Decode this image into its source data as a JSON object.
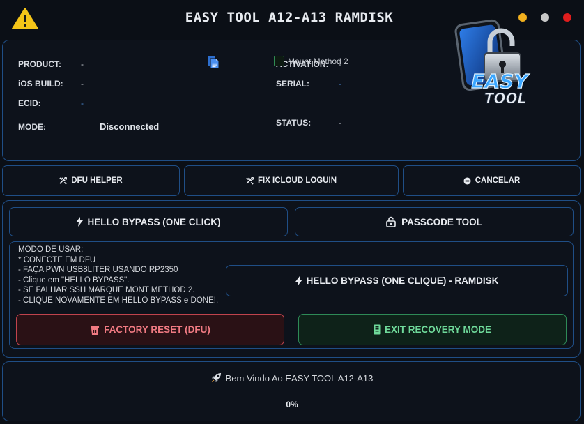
{
  "window": {
    "title": "EASY TOOL A12-A13 RAMDISK",
    "icon": "warning-icon",
    "controls": {
      "minimize_color": "#f2b01e",
      "maximize_color": "#c7c7c7",
      "close_color": "#e01d1d"
    }
  },
  "device_info": {
    "product_label": "PRODUCT:",
    "product_value": "-",
    "ios_build_label": "iOS BUILD:",
    "ios_build_value": "-",
    "ecid_label": "ECID:",
    "ecid_value": "-",
    "mode_label": "MODE:",
    "mode_value": "Disconnected",
    "activation_label": "ACTIVATION:",
    "activation_value": "-",
    "serial_label": "SERIAL:",
    "serial_value": "-",
    "mount_method_label": "Mount Method 2",
    "mount_method_checked": false,
    "status_label": "STATUS:",
    "status_value": "-",
    "copy_icon": "copy-icon"
  },
  "logo": {
    "line1": "EASY",
    "line2": "TOOL"
  },
  "toolbar": {
    "dfu_helper": "DFU HELPER",
    "fix_icloud": "FIX ICLOUD LOGUIN",
    "cancel": "CANCELAR"
  },
  "bypass": {
    "hello_bypass": "HELLO BYPASS (ONE CLICK)",
    "passcode_tool": "PASSCODE TOOL",
    "hello_bypass_ramdisk": "HELLO BYPASS (ONE CLIQUE) - RAMDISK",
    "factory_reset": "FACTORY RESET (DFU)",
    "exit_recovery": "EXIT RECOVERY MODE"
  },
  "instructions": {
    "lines": [
      "MODO DE USAR:",
      "* CONECTE EM DFU",
      "- FAÇA PWN USB8LITER USANDO RP2350",
      "- Clique em \"HELLO BYPASS\".",
      "- SE FALHAR SSH MARQUE MONT METHOD 2.",
      "- CLIQUE NOVAMENTE EM HELLO BYPASS e DONE!."
    ]
  },
  "status": {
    "welcome": "Bem Vindo Ao EASY TOOL A12-A13",
    "progress_text": "0%",
    "progress": 0
  },
  "colors": {
    "background": "#0b0f16",
    "border": "#1f4e86",
    "danger": "#f07a82",
    "success": "#6fd99a",
    "accent_blue": "#4a8ad4"
  }
}
